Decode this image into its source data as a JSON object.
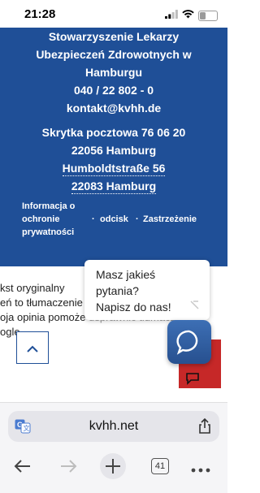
{
  "status": {
    "time": "21:28",
    "battery": "3",
    "battery_level": 0.3
  },
  "footer": {
    "org_line1": "Stowarzyszenie Lekarzy",
    "org_line2": "Ubezpieczeń Zdrowotnych w",
    "org_line3": "Hamburgu",
    "phone": "040 / 22 802 - 0",
    "email": "kontakt@kvhh.de",
    "pobox": "Skrytka pocztowa 76 06 20",
    "pobox_city": "22056 Hamburg",
    "street": "Humboldtstraße 56",
    "street_city": "22083 Hamburg",
    "links": {
      "privacy_line1": "Informacja o",
      "privacy_line2": "ochronie",
      "privacy_line3": "prywatności",
      "imprint": "odcisk",
      "disclaimer": "Zastrzeżenie",
      "separator": "·"
    }
  },
  "content": {
    "line1": "kst oryginalny",
    "line2": "eń to tłumaczenie",
    "line3": "oja opinia pomoże",
    "line3_faded": "usprawnić tłumaczeni",
    "line4": "ogle"
  },
  "chat": {
    "line1": "Masz jakieś",
    "line2": "pytania?",
    "line3": "Napisz do nas!"
  },
  "browser": {
    "url": "kvhh.net",
    "tab_count": "41"
  },
  "colors": {
    "footer_bg": "#1f4f97",
    "red_strip": "#c62828",
    "chat_btn": "#2f5d9f"
  },
  "icons": [
    "wifi-icon",
    "signal-icon",
    "battery-icon",
    "chevron-up-icon",
    "chat-bubble-icon",
    "translate-icon",
    "share-icon",
    "back-arrow-icon",
    "forward-arrow-icon",
    "new-tab-plus-icon",
    "tabs-icon",
    "more-icon",
    "feedback-icon"
  ]
}
